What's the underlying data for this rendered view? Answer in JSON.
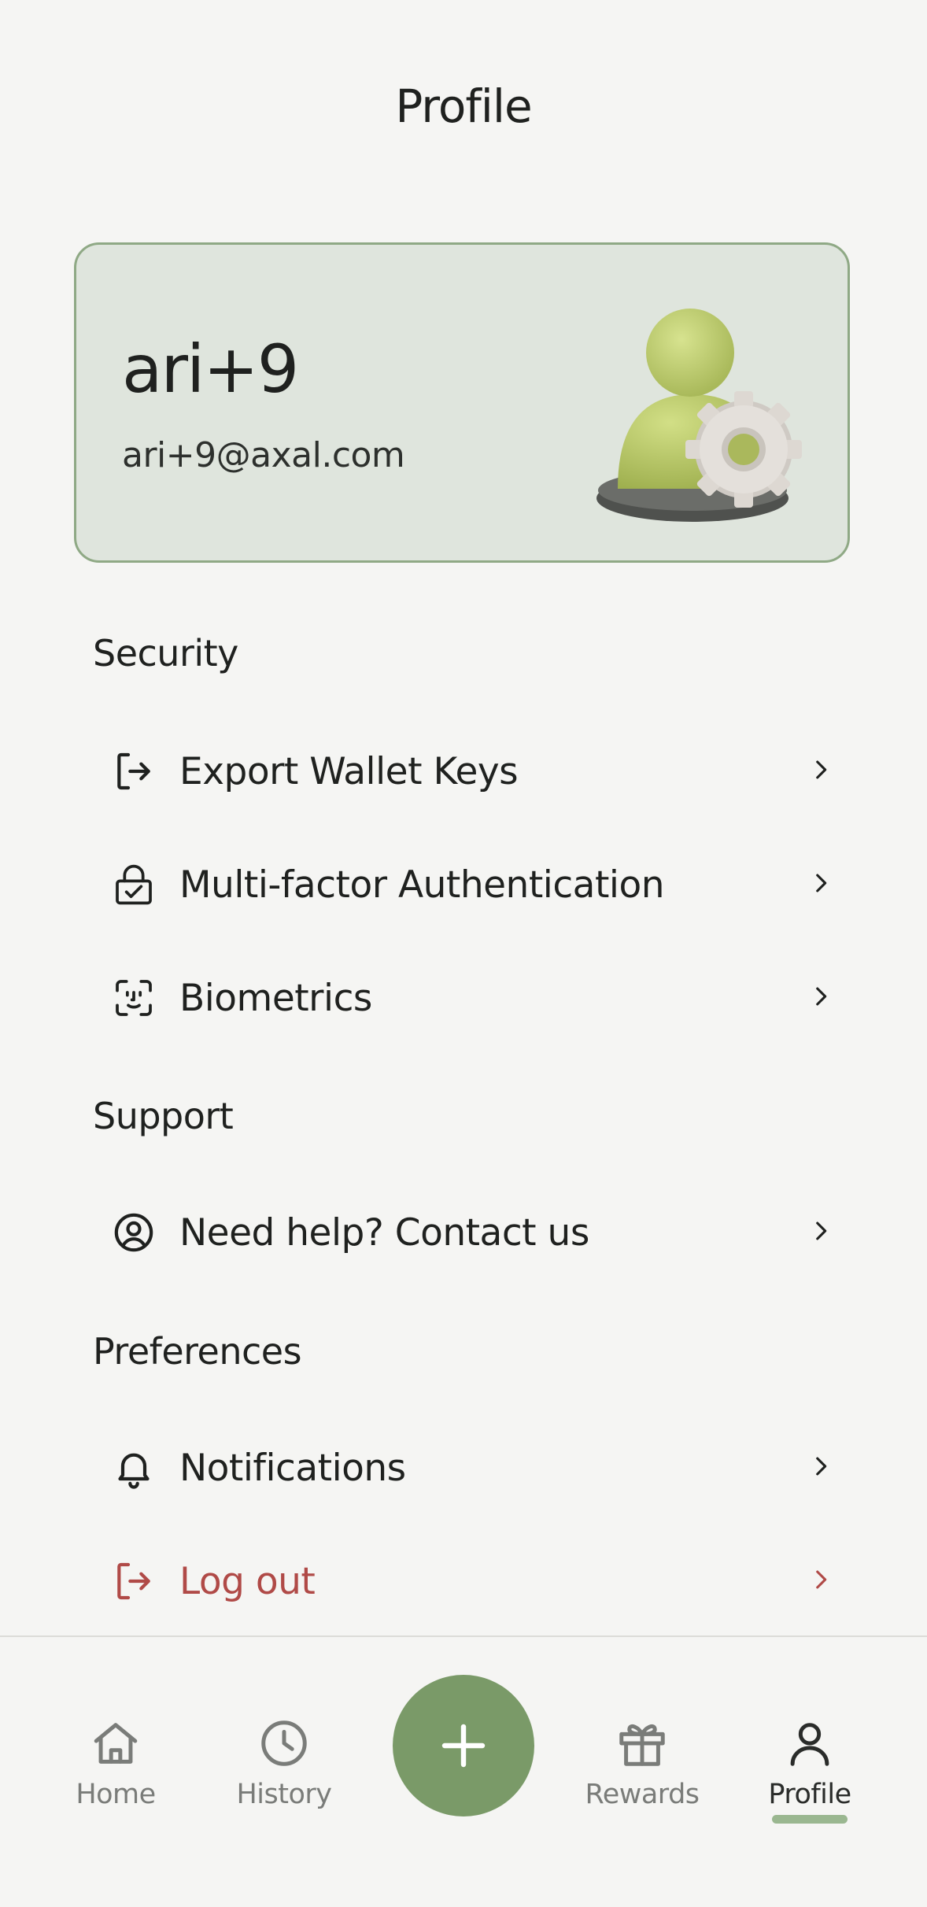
{
  "header": {
    "title": "Profile"
  },
  "profile": {
    "name": "ari+9",
    "email": "ari+9@axal.com"
  },
  "sections": {
    "security": {
      "title": "Security",
      "items": [
        {
          "label": "Export Wallet Keys",
          "icon": "export-icon"
        },
        {
          "label": "Multi-factor Authentication",
          "icon": "lock-check-icon"
        },
        {
          "label": "Biometrics",
          "icon": "face-id-icon"
        }
      ]
    },
    "support": {
      "title": "Support",
      "items": [
        {
          "label": "Need help? Contact us",
          "icon": "user-circle-icon"
        }
      ]
    },
    "preferences": {
      "title": "Preferences",
      "items": [
        {
          "label": "Notifications",
          "icon": "bell-icon"
        },
        {
          "label": "Log out",
          "icon": "logout-icon",
          "color": "#b04a47"
        }
      ]
    }
  },
  "tabs": [
    {
      "label": "Home",
      "icon": "home-icon"
    },
    {
      "label": "History",
      "icon": "clock-icon"
    },
    {
      "label": "Rewards",
      "icon": "gift-icon"
    },
    {
      "label": "Profile",
      "icon": "user-icon",
      "active": true
    }
  ],
  "colors": {
    "accent": "#7a9a68",
    "card_bg": "#dfe5dd",
    "card_border": "#8fa985",
    "danger": "#b04a47",
    "background": "#f5f5f3"
  }
}
